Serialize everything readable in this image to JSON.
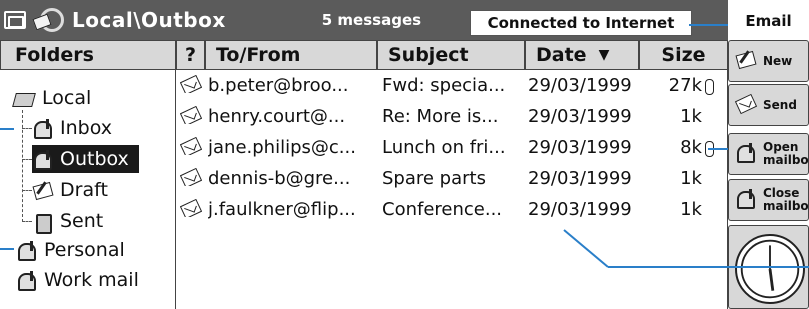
{
  "title_bar": {
    "folder_path": "Local\\Outbox",
    "message_count": "5 messages",
    "connection_status": "Connected to Internet"
  },
  "toolbar_tab": "Email",
  "folders_panel": {
    "header": "Folders",
    "items": [
      {
        "label": "Local",
        "icon": "open-folder-icon"
      },
      {
        "label": "Inbox",
        "icon": "mailbox-icon"
      },
      {
        "label": "Outbox",
        "icon": "mailbox-icon",
        "selected": true
      },
      {
        "label": "Draft",
        "icon": "pencil-envelope-icon"
      },
      {
        "label": "Sent",
        "icon": "bin-icon"
      },
      {
        "label": "Personal",
        "icon": "mailbox-icon"
      },
      {
        "label": "Work mail",
        "icon": "mailbox-icon"
      }
    ]
  },
  "message_list": {
    "columns": [
      "?",
      "To/From",
      "Subject",
      "Date",
      "Size"
    ],
    "sort_indicator": "▼",
    "rows": [
      {
        "to_from": "b.peter@broo...",
        "subject": "Fwd: specia...",
        "date": "29/03/1999",
        "size": "27k",
        "attachment": true
      },
      {
        "to_from": "henry.court@...",
        "subject": "Re: More is...",
        "date": "29/03/1999",
        "size": "1k",
        "attachment": false
      },
      {
        "to_from": "jane.philips@c...",
        "subject": "Lunch on fri...",
        "date": "29/03/1999",
        "size": "8k",
        "attachment": true
      },
      {
        "to_from": "dennis-b@gre...",
        "subject": "Spare parts",
        "date": "29/03/1999",
        "size": "1k",
        "attachment": false
      },
      {
        "to_from": "j.faulkner@flip...",
        "subject": "Conference...",
        "date": "29/03/1999",
        "size": "1k",
        "attachment": false
      }
    ]
  },
  "right_toolbar": {
    "new_label": "New",
    "send_label": "Send",
    "open_mailbox_label": [
      "Open",
      "mailbox"
    ],
    "close_mailbox_label": [
      "Close",
      "mailbox"
    ]
  },
  "colors": {
    "title_bar": "#5b5b5b",
    "header_bg": "#d8d8d8",
    "selection": "#1a1a1a",
    "callout": "#2a7fc9"
  }
}
